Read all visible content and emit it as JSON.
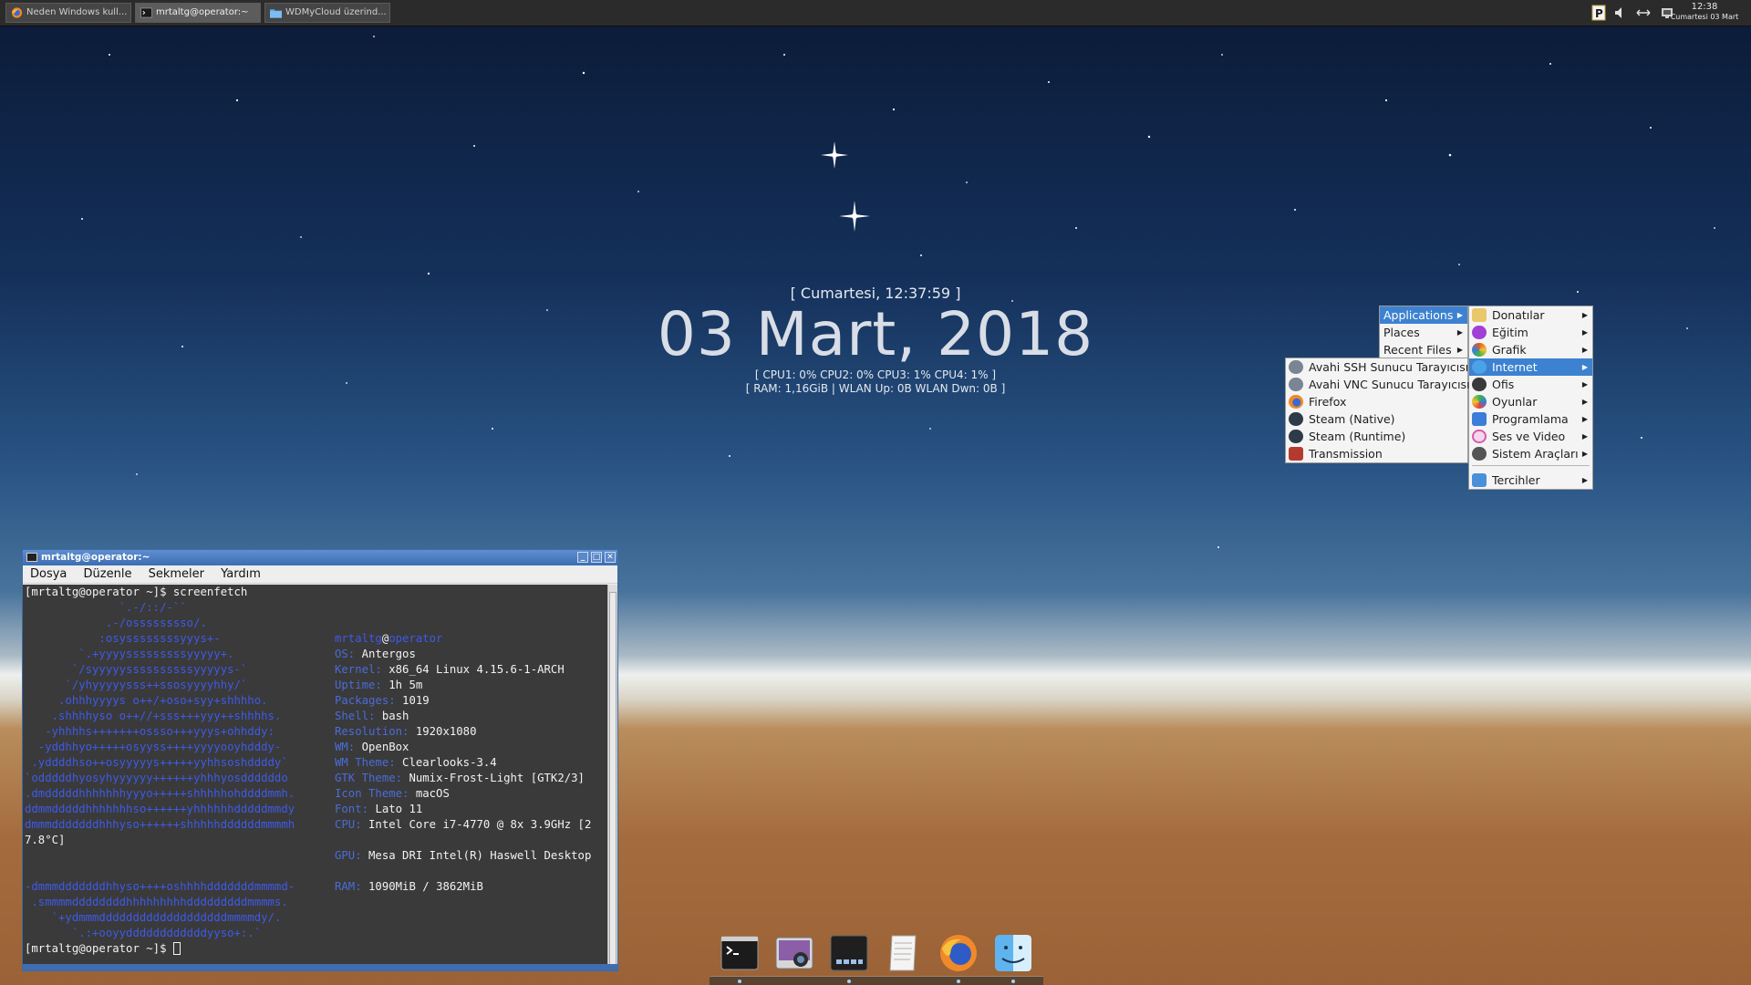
{
  "taskbar": {
    "tasks": [
      {
        "label": "Neden Windows kull...",
        "icon": "firefox-icon"
      },
      {
        "label": "mrtaltg@operator:~",
        "icon": "terminal-icon",
        "active": true
      },
      {
        "label": "WDMyCloud üzerind...",
        "icon": "folder-icon"
      }
    ],
    "clock_time": "12:38",
    "clock_date": "Cumartesi 03 Mart"
  },
  "conky": {
    "day_line": "[ Cumartesi, 12:37:59 ]",
    "date": "03 Mart, 2018",
    "cpu_line": "[ CPU1: 0% CPU2: 0% CPU3: 1% CPU4: 1% ]",
    "ram_line": "[ RAM: 1,16GiB | WLAN Up: 0B   WLAN Dwn: 0B   ]"
  },
  "menu_root": {
    "items": [
      {
        "label": "Applications",
        "selected": true
      },
      {
        "label": "Places"
      },
      {
        "label": "Recent Files"
      }
    ]
  },
  "menu_categories": {
    "items": [
      {
        "label": "Donatılar",
        "icon": "accessories-icon",
        "color": "#e8c86a"
      },
      {
        "label": "Eğitim",
        "icon": "education-icon",
        "color": "#a23fd6"
      },
      {
        "label": "Grafik",
        "icon": "graphics-icon",
        "color": "#e05b2a"
      },
      {
        "label": "Internet",
        "icon": "internet-icon",
        "color": "#4aa3e6",
        "selected": true
      },
      {
        "label": "Ofis",
        "icon": "office-icon",
        "color": "#3a3a3a"
      },
      {
        "label": "Oyunlar",
        "icon": "games-icon",
        "color": "#3cb44b"
      },
      {
        "label": "Programlama",
        "icon": "programming-icon",
        "color": "#3b7dd8"
      },
      {
        "label": "Ses ve Video",
        "icon": "multimedia-icon",
        "color": "#d85ab0"
      },
      {
        "label": "Sistem Araçları",
        "icon": "system-tools-icon",
        "color": "#555555"
      },
      {
        "label": "Tercihler",
        "icon": "preferences-icon",
        "color": "#4a90d9"
      }
    ]
  },
  "menu_internet": {
    "items": [
      {
        "label": "Avahi SSH Sunucu Tarayıcısı",
        "icon": "avahi-ssh-icon",
        "color": "#7a8594"
      },
      {
        "label": "Avahi VNC Sunucu Tarayıcısı",
        "icon": "avahi-vnc-icon",
        "color": "#7a8594"
      },
      {
        "label": "Firefox",
        "icon": "firefox-icon",
        "color": "#f0892a"
      },
      {
        "label": "Steam (Native)",
        "icon": "steam-icon",
        "color": "#2d3a4a"
      },
      {
        "label": "Steam (Runtime)",
        "icon": "steam-icon",
        "color": "#2d3a4a"
      },
      {
        "label": "Transmission",
        "icon": "transmission-icon",
        "color": "#b53a2e"
      }
    ]
  },
  "terminal": {
    "title": "mrtaltg@operator:~",
    "menus": [
      "Dosya",
      "Düzenle",
      "Sekmeler",
      "Yardım"
    ],
    "prompt": "[mrtaltg@operator ~]$",
    "command": "screenfetch",
    "user": "mrtaltg",
    "at": "@",
    "host": "operator",
    "info": [
      {
        "label": "OS:",
        "value": "Antergos"
      },
      {
        "label": "Kernel:",
        "value": "x86_64 Linux 4.15.6-1-ARCH"
      },
      {
        "label": "Uptime:",
        "value": "1h 5m"
      },
      {
        "label": "Packages:",
        "value": "1019"
      },
      {
        "label": "Shell:",
        "value": "bash"
      },
      {
        "label": "Resolution:",
        "value": "1920x1080"
      },
      {
        "label": "WM:",
        "value": "OpenBox"
      },
      {
        "label": "WM Theme:",
        "value": "Clearlooks-3.4"
      },
      {
        "label": "GTK Theme:",
        "value": "Numix-Frost-Light [GTK2/3]"
      },
      {
        "label": "Icon Theme:",
        "value": "macOS"
      },
      {
        "label": "Font:",
        "value": "Lato 11"
      },
      {
        "label": "CPU:",
        "value": "Intel Core i7-4770 @ 8x 3.9GHz [2"
      },
      {
        "label": "GPU:",
        "value": "Mesa DRI Intel(R) Haswell Desktop"
      },
      {
        "label": "RAM:",
        "value": "1090MiB / 3862MiB"
      }
    ],
    "cpu_wrap": "7.8°C]",
    "art": [
      "              `.-/::/-``",
      "            .-/osssssssso/.",
      "           :osyssssssssyyys+-",
      "        `.+yyyysssssssssyyyyy+.",
      "       `/syyyyyssssssssssyyyyys-`",
      "      `/yhyyyyysss++ssosyyyyhhy/`",
      "     .ohhhyyyys o++/+oso+syy+shhhho.",
      "    .shhhhyso o++//+sss+++yyy++shhhhs.",
      "   -yhhhhs+++++++ossso+++yyys+ohhddy:",
      "  -yddhhyo+++++osyyss++++yyyyooyhdddy-",
      " .yddddhso++osyyyyys+++++yyhhsoshddddy`",
      "`odddddhyosyhyyyyyy++++++yhhhyosddddddo",
      ".dmdddddhhhhhhhyyyo+++++shhhhhohddddmmh.",
      "ddmmdddddhhhhhhhso++++++yhhhhhhdddddmmdy",
      "dmmmdddddddhhhyso++++++shhhhhddddddmmmmh",
      "",
      "-dmmmdddddddhhyso++++oshhhhdddddddmmmmd-",
      " .smmmmddddddddhhhhhhhhhdddddddddmmmms.",
      "    `+ydmmmdddddddddddddddddddmmmmdy/.",
      "       `.:+ooyyddddddddddddyyso+:.`"
    ]
  },
  "dock": {
    "items": [
      {
        "icon": "terminal-icon"
      },
      {
        "icon": "screenshot-icon"
      },
      {
        "icon": "system-monitor-icon"
      },
      {
        "icon": "text-editor-icon"
      },
      {
        "icon": "firefox-icon"
      },
      {
        "icon": "finder-icon"
      }
    ]
  }
}
